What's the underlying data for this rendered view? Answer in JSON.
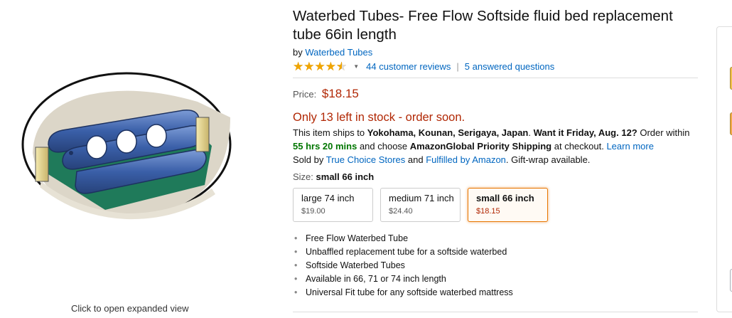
{
  "product": {
    "title": "Waterbed Tubes- Free Flow Softside fluid bed replacement tube 66in length",
    "by_prefix": "by",
    "brand": "Waterbed Tubes",
    "rating": 4.5,
    "reviews": "44 customer reviews",
    "separator": "|",
    "answered": "5 answered questions"
  },
  "pricing": {
    "label": "Price:",
    "price": "$18.15",
    "stock": "Only 13 left in stock - order soon."
  },
  "shipping": {
    "t1": "This item ships to ",
    "location": "Yokohama, Kounan, Serigaya, Japan",
    "t2": ". ",
    "want": "Want it Friday, Aug. 12?",
    "t3": " Order within",
    "countdown": "55 hrs 20 mins",
    "t4": " and choose ",
    "method": "AmazonGlobal Priority Shipping",
    "t5": " at checkout. ",
    "learn_more": "Learn more",
    "sold_by": "Sold by ",
    "seller": "True Choice Stores",
    "and": " and ",
    "fulfilled": "Fulfilled by Amazon",
    "gift": ". Gift-wrap available."
  },
  "size": {
    "label": "Size:",
    "selected": "small 66 inch",
    "options": [
      {
        "name": "large 74 inch",
        "price": "$19.00"
      },
      {
        "name": "medium 71 inch",
        "price": "$24.40"
      },
      {
        "name": "small 66 inch",
        "price": "$18.15"
      }
    ]
  },
  "bullets": [
    "Free Flow Waterbed Tube",
    "Unbaffled replacement tube for a softside waterbed",
    "Softside Waterbed Tubes",
    "Available in 66, 71 or 74 inch length",
    "Universal Fit tube for any softside waterbed mattress"
  ],
  "image": {
    "expand_text": "Click to open expanded view"
  },
  "colors": {
    "link": "#0066c0",
    "price": "#b12704",
    "star": "#f0a500",
    "tube_blue": "#3a5fa8",
    "base_green": "#1f7a5a"
  }
}
